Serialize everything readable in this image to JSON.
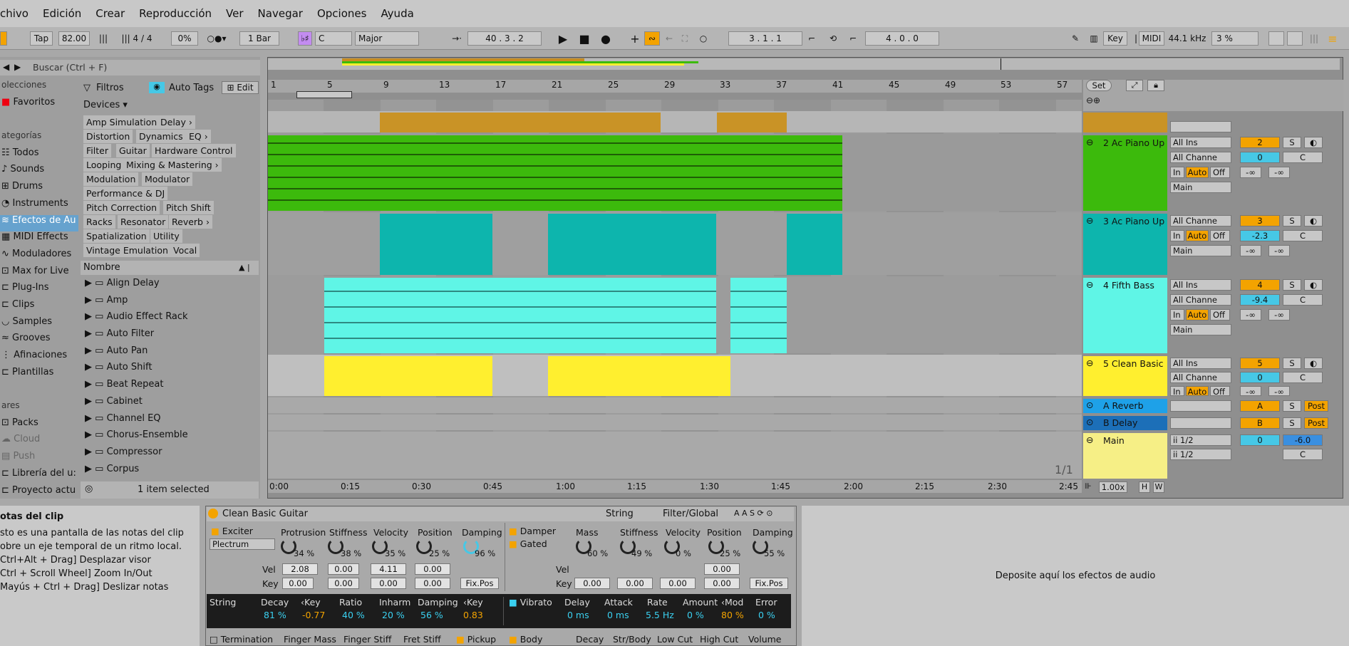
{
  "menu": [
    "chivo",
    "Edición",
    "Crear",
    "Reproducción",
    "Ver",
    "Navegar",
    "Opciones",
    "Ayuda"
  ],
  "transport": {
    "tap": "Tap",
    "tempo": "82.00",
    "signature_num": "4",
    "signature_slash": "/",
    "signature_den": "4",
    "groove": "0%",
    "quantize": "1 Bar",
    "key": "C",
    "scale": "Major",
    "position": "40 .  3 .  2",
    "loop_start": "3 .  1 .  1",
    "loop_length": "4 .  0 .  0",
    "key_label": "Key",
    "midi_label": "MIDI",
    "sample_rate": "44.1 kHz",
    "cpu": "3 %"
  },
  "browser": {
    "search_placeholder": "Buscar (Ctrl + F)",
    "places": [
      {
        "label": "olecciones",
        "head": true
      },
      {
        "label": "Favoritos"
      },
      {
        "label": ""
      },
      {
        "label": "ategorías",
        "head": true
      },
      {
        "label": "Todos"
      },
      {
        "label": "Sounds"
      },
      {
        "label": "Drums"
      },
      {
        "label": "Instruments"
      },
      {
        "label": "Efectos de Au",
        "selected": true
      },
      {
        "label": "MIDI Effects"
      },
      {
        "label": "Moduladores"
      },
      {
        "label": "Max for Live"
      },
      {
        "label": "Plug-Ins"
      },
      {
        "label": "Clips"
      },
      {
        "label": "Samples"
      },
      {
        "label": "Grooves"
      },
      {
        "label": "Afinaciones"
      },
      {
        "label": "Plantillas"
      },
      {
        "label": ""
      },
      {
        "label": "ares",
        "head": true
      },
      {
        "label": "Packs"
      },
      {
        "label": "Cloud"
      },
      {
        "label": "Push"
      },
      {
        "label": "Librería del u:"
      },
      {
        "label": "Proyecto actu"
      }
    ],
    "filters_label": "Filtros",
    "autotags_label": "Auto Tags",
    "edit_label": "Edit",
    "devices_label": "Devices ▾",
    "chips": [
      [
        "Amp Simulation",
        "Delay ›"
      ],
      [
        "Distortion",
        "Dynamics",
        "EQ ›"
      ],
      [
        "Filter",
        "Guitar",
        "Hardware Control"
      ],
      [
        "Looping",
        "Mixing & Mastering ›"
      ],
      [
        "Modulation",
        "Modulator"
      ],
      [
        "Performance & DJ"
      ],
      [
        "Pitch Correction",
        "Pitch Shift"
      ],
      [
        "Racks",
        "Resonator",
        "Reverb ›"
      ],
      [
        "Spatialization",
        "Utility"
      ],
      [
        "Vintage Emulation",
        "Vocal"
      ]
    ],
    "name_header": "Nombre",
    "items": [
      "Align Delay",
      "Amp",
      "Audio Effect Rack",
      "Auto Filter",
      "Auto Pan",
      "Auto Shift",
      "Beat Repeat",
      "Cabinet",
      "Channel EQ",
      "Chorus-Ensemble",
      "Compressor",
      "Corpus"
    ],
    "status": "1 item selected"
  },
  "arrangement": {
    "bar_ticks": [
      "1",
      "5",
      "9",
      "13",
      "17",
      "21",
      "25",
      "29",
      "33",
      "37",
      "41",
      "45",
      "49",
      "53",
      "57"
    ],
    "time_ticks": [
      "0:00",
      "0:15",
      "0:30",
      "0:45",
      "1:00",
      "1:15",
      "1:30",
      "1:45",
      "2:00",
      "2:15",
      "2:30",
      "2:45"
    ],
    "set_label": "Set",
    "page_label": "1/1",
    "zoom": "1.00x",
    "h_label": "H",
    "w_label": "W"
  },
  "tracks": [
    {
      "name": "2 Ac Piano Up",
      "color": "#3cba0c",
      "number": "2",
      "input": "All Ins",
      "channel": "All Channe",
      "vol": "0",
      "pan": "C",
      "out": "Main"
    },
    {
      "name": "3 Ac Piano Up",
      "color": "#0db5ad",
      "number": "3",
      "input": "All Channe",
      "vol": "-2.3",
      "pan": "C",
      "out": "Main"
    },
    {
      "name": "4 Fifth Bass",
      "color": "#5ff5e6",
      "number": "4",
      "input": "All Ins",
      "channel": "All Channe",
      "vol": "-9.4",
      "pan": "C",
      "out": "Main"
    },
    {
      "name": "5 Clean Basic",
      "color": "#ffef2f",
      "number": "5",
      "input": "All Ins",
      "channel": "All Channe",
      "vol": "0",
      "pan": "C"
    },
    {
      "name": "A Reverb",
      "color": "#1ea1e8",
      "number": "A",
      "send": "Post"
    },
    {
      "name": "B Delay",
      "color": "#1c6fb8",
      "number": "B",
      "send": "Post"
    },
    {
      "name": "Main",
      "color": "#f6ef86",
      "vol": "0",
      "pan": "-6.0",
      "cue": "C",
      "io1": "ii 1/2",
      "io2": "ii 1/2"
    }
  ],
  "mixer_labels": {
    "in": "In",
    "auto": "Auto",
    "off": "Off",
    "s": "S",
    "neg_inf": "-∞"
  },
  "info": {
    "title": "otas del clip",
    "lines": [
      "sto es una pantalla de las notas del clip",
      "obre un eje temporal de un ritmo local.",
      "",
      "Ctrl+Alt + Drag] Desplazar visor",
      "Ctrl + Scroll Wheel] Zoom In/Out",
      "Mayús + Ctrl + Drag] Deslizar notas"
    ]
  },
  "device": {
    "name": "Clean Basic Guitar",
    "tabs": [
      "String",
      "Filter/Global"
    ],
    "exciter": "Exciter",
    "exciter_type": "Plectrum",
    "exciter_params": [
      {
        "name": "Protrusion",
        "val": "34 %"
      },
      {
        "name": "Stiffness",
        "val": "38 %"
      },
      {
        "name": "Velocity",
        "val": "35 %"
      },
      {
        "name": "Position",
        "val": "25 %"
      },
      {
        "name": "Damping",
        "val": "96 %"
      }
    ],
    "damper": "Damper",
    "gated": "Gated",
    "damper_params": [
      {
        "name": "Mass",
        "val": "60 %"
      },
      {
        "name": "Stiffness",
        "val": "49 %"
      },
      {
        "name": "Velocity",
        "val": "0 %"
      },
      {
        "name": "Position",
        "val": "25 %"
      },
      {
        "name": "Damping",
        "val": "55 %"
      }
    ],
    "vel_label": "Vel",
    "key_label": "Key",
    "vel_values": [
      "2.08",
      "0.00",
      "4.11",
      "0.00"
    ],
    "key_values": [
      "0.00",
      "0.00",
      "0.00",
      "0.00"
    ],
    "damper_vel": "0.00",
    "damper_key": [
      "0.00",
      "0.00",
      "0.00",
      "0.00"
    ],
    "fixpos": "Fix.Pos",
    "string_params": [
      {
        "name": "Decay",
        "val": "81 %"
      },
      {
        "name": "‹Key",
        "val": "-0.77",
        "orange": true
      },
      {
        "name": "Ratio",
        "val": "40 %"
      },
      {
        "name": "Inharm",
        "val": "20 %"
      },
      {
        "name": "Damping",
        "val": "56 %"
      },
      {
        "name": "‹Key",
        "val": "0.83",
        "orange": true
      }
    ],
    "string_label": "String",
    "vibrato_label": "Vibrato",
    "vibrato_params": [
      {
        "name": "Delay",
        "val": "0 ms"
      },
      {
        "name": "Attack",
        "val": "0 ms"
      },
      {
        "name": "Rate",
        "val": "5.5 Hz"
      },
      {
        "name": "Amount",
        "val": "0 %"
      },
      {
        "name": "‹Mod",
        "val": "80 %",
        "orange": true
      },
      {
        "name": "Error",
        "val": "0 %"
      }
    ],
    "bottom_labels": [
      "Termination",
      "Finger Mass",
      "Finger Stiff",
      "Fret Stiff",
      "Pickup",
      "Body",
      "Decay",
      "Str/Body",
      "Low Cut",
      "High Cut",
      "Volume"
    ]
  },
  "dropzone": "Deposite aquí los efectos de audio"
}
